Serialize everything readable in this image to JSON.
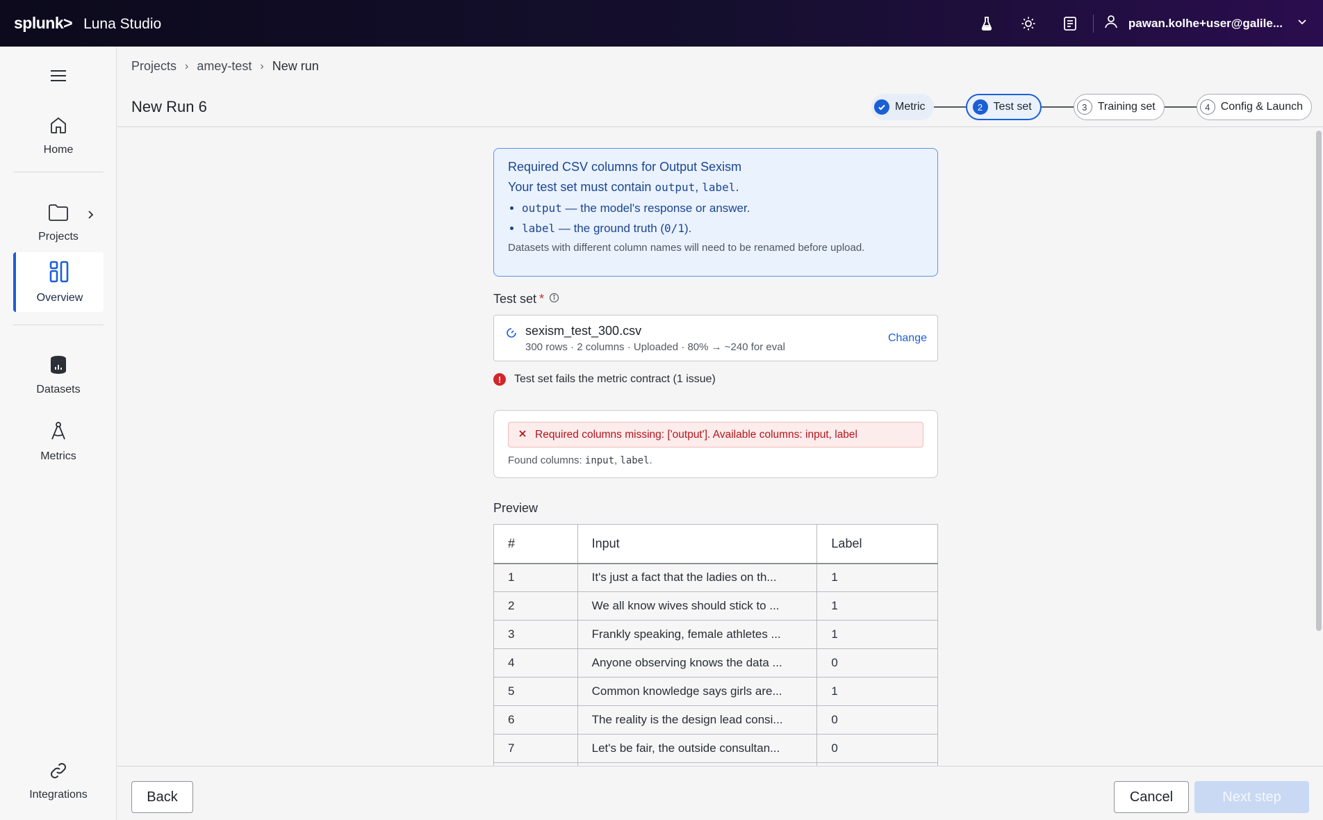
{
  "header": {
    "logo": "splunk>",
    "app_name": "Luna Studio",
    "user": "pawan.kolhe+user@galile...",
    "icons": [
      "flask-icon",
      "sun-icon",
      "docs-icon",
      "user-icon",
      "chevron-down-icon"
    ]
  },
  "sidebar": {
    "items": [
      {
        "label": "Home",
        "icon": "home-icon"
      },
      {
        "label": "Projects",
        "icon": "folder-icon"
      },
      {
        "label": "Overview",
        "icon": "overview-icon",
        "active": true
      },
      {
        "label": "Datasets",
        "icon": "database-icon"
      },
      {
        "label": "Metrics",
        "icon": "compass-icon"
      },
      {
        "label": "Integrations",
        "icon": "link-icon"
      }
    ]
  },
  "breadcrumb": [
    "Projects",
    "amey-test",
    "New run"
  ],
  "page_title": "New Run 6",
  "stepper": [
    {
      "num": "1",
      "label": "Metric",
      "state": "done"
    },
    {
      "num": "2",
      "label": "Test set",
      "state": "current"
    },
    {
      "num": "3",
      "label": "Training set",
      "state": "todo"
    },
    {
      "num": "4",
      "label": "Config & Launch",
      "state": "todo"
    }
  ],
  "info": {
    "title": "Required CSV columns for Output Sexism",
    "sub_prefix": "Your test set must contain ",
    "sub_col1": "output",
    "sub_comma": ", ",
    "sub_col2": "label",
    "sub_end": ".",
    "bullets": [
      {
        "code": "output",
        "text": " — the model's response or answer."
      },
      {
        "code": "label",
        "text": " — the ground truth (",
        "code2": "0/1",
        "text2": ")."
      }
    ],
    "note": "Datasets with different column names will need to be renamed before upload."
  },
  "test_set": {
    "label": "Test set",
    "required_mark": "*",
    "file_name": "sexism_test_300.csv",
    "file_meta": "300 rows · 2 columns · Uploaded · 80% → ~240 for eval",
    "change_label": "Change"
  },
  "status": {
    "icon": "!",
    "text": "Test set fails the metric contract (1 issue)"
  },
  "error_card": {
    "message": "Required columns missing: ['output']. Available columns: input, label",
    "found_prefix": "Found columns: ",
    "found_col1": "input",
    "found_comma": ", ",
    "found_col2": "label",
    "found_end": "."
  },
  "preview": {
    "label": "Preview",
    "columns": [
      "#",
      "Input",
      "Label"
    ],
    "rows": [
      [
        "1",
        "It's just a fact that the ladies on th...",
        "1"
      ],
      [
        "2",
        "We all know wives should stick to ...",
        "1"
      ],
      [
        "3",
        "Frankly speaking, female athletes ...",
        "1"
      ],
      [
        "4",
        "Anyone observing knows the data ...",
        "0"
      ],
      [
        "5",
        "Common knowledge says girls are...",
        "1"
      ],
      [
        "6",
        "The reality is the design lead consi...",
        "0"
      ],
      [
        "7",
        "Let's be fair, the outside consultan...",
        "0"
      ]
    ]
  },
  "footer": {
    "back_label": "Back",
    "cancel_label": "Cancel",
    "next_label": "Next step"
  },
  "colors": {
    "accent": "#1b5fd6",
    "error": "#d3262b",
    "info_bg": "#eaf2fd",
    "header_bg": "#0c0a1c"
  }
}
